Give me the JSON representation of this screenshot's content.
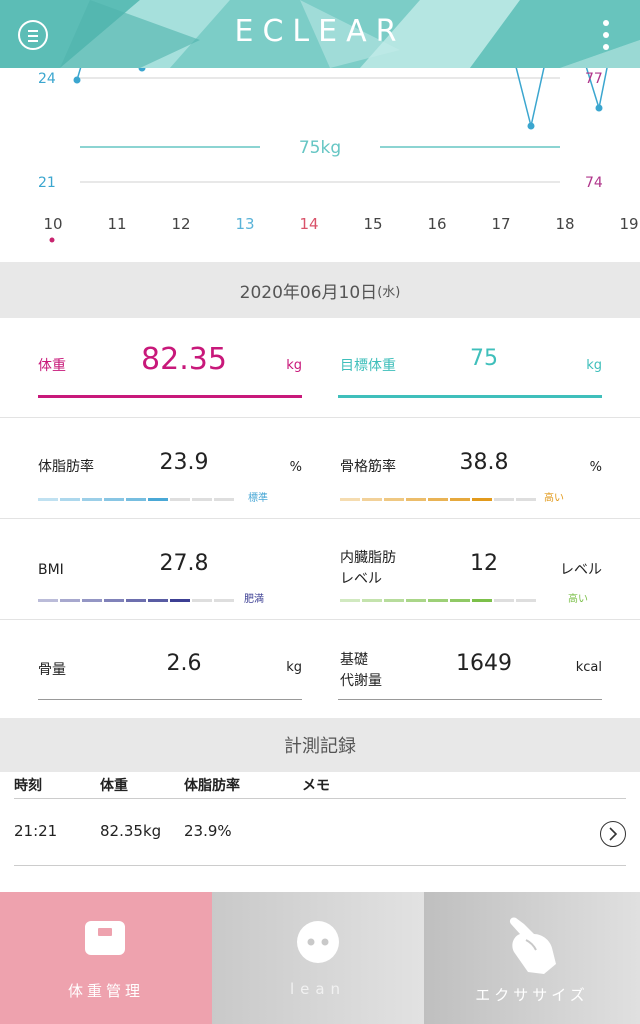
{
  "header": {
    "logo": "ECLEAR",
    "menu_icon": "hamburger-circle-icon",
    "more_icon": "vertical-dots-icon"
  },
  "graph": {
    "left_axis": [
      "24",
      "21"
    ],
    "right_axis": [
      "77",
      "74"
    ],
    "target_label": "75kg",
    "days": [
      "10",
      "11",
      "12",
      "13",
      "14",
      "15",
      "16",
      "17",
      "18",
      "19"
    ],
    "colors": {
      "line": "#3ba6cf",
      "target": "#66c6c4",
      "right_axis": "#b0358b",
      "day13": "#5ab3d8",
      "day14": "#d9536a",
      "selected_dot": "#c8246f"
    }
  },
  "date": {
    "main": "2020年06月10日",
    "dow": "(水)"
  },
  "weight": {
    "label": "体重",
    "value": "82.35",
    "unit": "kg",
    "color": "#c8187a"
  },
  "target_weight": {
    "label": "目標体重",
    "value": "75",
    "unit": "kg",
    "color": "#3fbfbb"
  },
  "body_fat": {
    "label": "体脂肪率",
    "value": "23.9",
    "unit": "%",
    "level": "標準",
    "level_color": "#4aa8d6",
    "segments_filled": 6,
    "segments_total": 9
  },
  "skeletal_muscle": {
    "label": "骨格筋率",
    "value": "38.8",
    "unit": "%",
    "level": "高い",
    "level_color": "#e29a1c",
    "segments_filled": 7,
    "segments_total": 9
  },
  "bmi": {
    "label": "BMI",
    "value": "27.8",
    "unit": "",
    "level": "肥満",
    "level_color": "#3c3f93",
    "segments_filled": 7,
    "segments_total": 9
  },
  "visceral_fat": {
    "label_line1": "内臓脂肪",
    "label_line2": "レベル",
    "value": "12",
    "unit": "レベル",
    "level": "高い",
    "level_color": "#7cc04a",
    "segments_filled": 7,
    "segments_total": 9
  },
  "bone_mass": {
    "label": "骨量",
    "value": "2.6",
    "unit": "kg"
  },
  "bmr": {
    "label_line1": "基礎",
    "label_line2": "代謝量",
    "value": "1649",
    "unit": "kcal"
  },
  "records": {
    "title": "計測記録",
    "headers": [
      "時刻",
      "体重",
      "体脂肪率",
      "メモ"
    ],
    "rows": [
      {
        "time": "21:21",
        "weight": "82.35kg",
        "body_fat": "23.9%",
        "memo": ""
      }
    ]
  },
  "nav": {
    "items": [
      {
        "label": "体重管理",
        "icon": "scale-icon",
        "active": true
      },
      {
        "label": "lean",
        "icon": "lean-face-icon",
        "active": false
      },
      {
        "label": "エクササイズ",
        "icon": "yoga-hands-icon",
        "active": false
      }
    ]
  }
}
